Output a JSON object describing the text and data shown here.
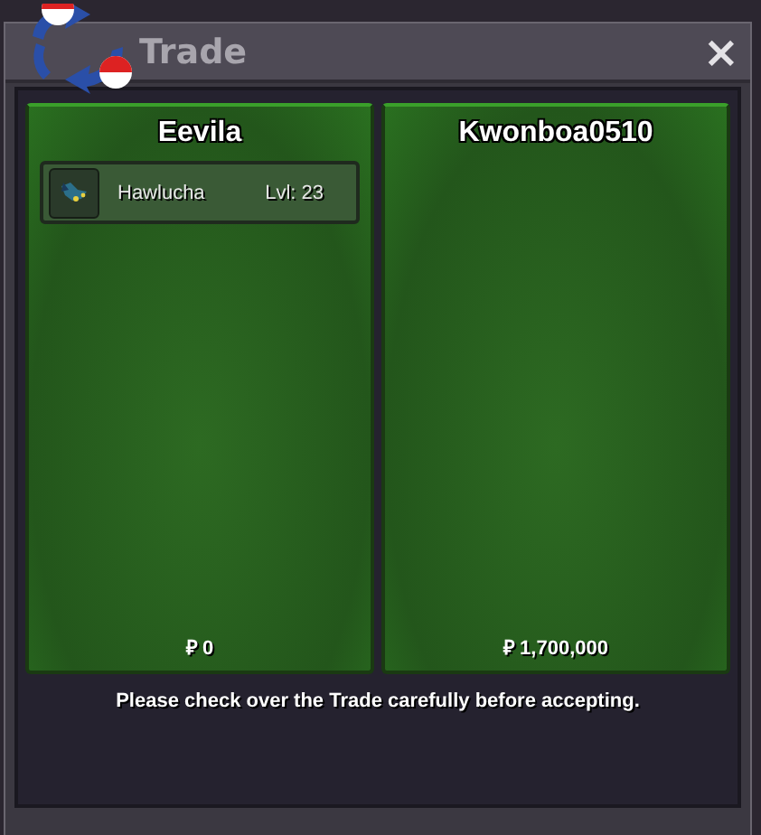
{
  "window": {
    "title": "Trade"
  },
  "close_button": {
    "label": "×"
  },
  "traders": [
    {
      "name": "Eevila",
      "items": [
        {
          "name": "Hawlucha",
          "level": "Lvl: 23"
        }
      ],
      "money": "₽ 0"
    },
    {
      "name": "Kwonboa0510",
      "money": "₽ 1,700,000"
    }
  ],
  "notice": "Please check over the Trade carefully before accepting."
}
